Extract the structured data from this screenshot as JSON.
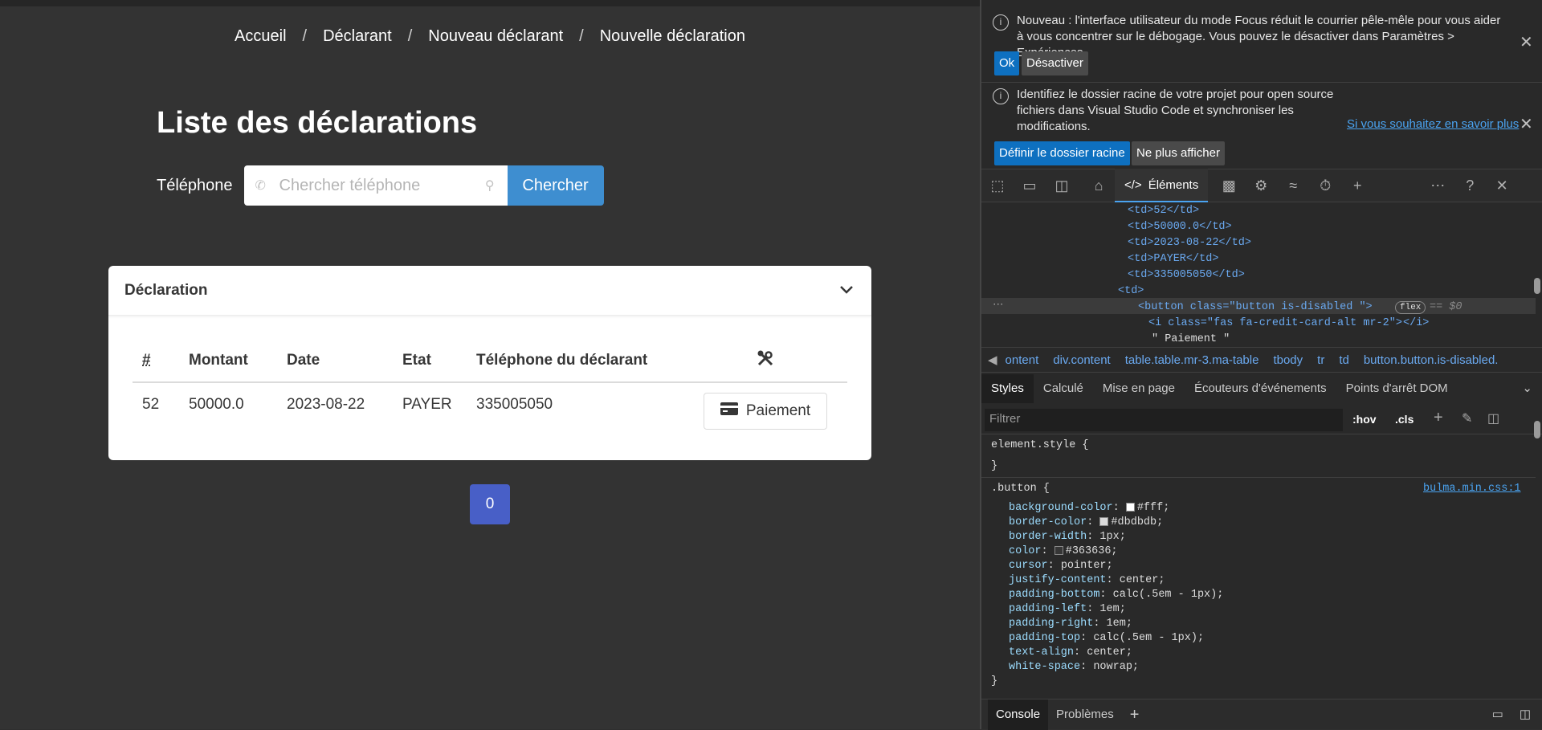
{
  "breadcrumb": {
    "items": [
      "Accueil",
      "Déclarant",
      "Nouveau déclarant",
      "Nouvelle déclaration"
    ],
    "separator": "/"
  },
  "page": {
    "title": "Liste des déclarations"
  },
  "search": {
    "label": "Téléphone",
    "placeholder": "Chercher téléphone",
    "button_label": "Chercher"
  },
  "card": {
    "title": "Déclaration",
    "columns": [
      "#",
      "Montant",
      "Date",
      "Etat",
      "Téléphone du déclarant"
    ],
    "rows": [
      {
        "id": "52",
        "montant": "50000.0",
        "date": "2023-08-22",
        "etat": "PAYER",
        "telephone": "335005050",
        "action_label": "Paiement"
      }
    ]
  },
  "pagination": {
    "current": "0"
  },
  "devtools": {
    "notice1": {
      "text": "Nouveau : l'interface utilisateur du mode Focus réduit le courrier pêle-mêle pour vous aider à vous concentrer sur le débogage. Vous pouvez le désactiver dans Paramètres > Expériences.",
      "ok_label": "Ok",
      "disable_label": "Désactiver"
    },
    "notice2": {
      "text": "Identifiez le dossier racine de votre projet pour open source fichiers dans Visual Studio Code et synchroniser les modifications.",
      "link": "Si vous souhaitez en savoir plus",
      "define_label": "Définir le dossier racine",
      "dismiss_label": "Ne plus afficher"
    },
    "elements_tab": "Éléments",
    "code": {
      "l1": "<td>52</td>",
      "l2": "<td>50000.0</td>",
      "l3": "<td>2023-08-22</td>",
      "l4": "<td>PAYER</td>",
      "l5": "<td>335005050</td>",
      "l6": "<td>",
      "l7_tag": "<button class=\"button is-disabled  \">",
      "l7_badge": "flex",
      "l7_eq": "== $0",
      "l8": "<i class=\"fas fa-credit-card-alt mr-2\">",
      "l8_end": "</i>",
      "l9": "\" Paiement \""
    },
    "crumbs": [
      "ontent",
      "div.content",
      "table.table.mr-3.ma-table",
      "tbody",
      "tr",
      "td",
      "button.button.is-disabled."
    ],
    "subtabs": [
      "Styles",
      "Calculé",
      "Mise en page",
      "Écouteurs d'événements",
      "Points d'arrêt DOM"
    ],
    "filter_placeholder": "Filtrer",
    "hov": ":hov",
    "cls": ".cls",
    "styles": {
      "element_style": "element.style {",
      "close": "}",
      "selector": ".button {",
      "source": "bulma.min.css:1",
      "props": [
        {
          "name": "background-color",
          "value": "#fff;",
          "swatch": "#ffffff"
        },
        {
          "name": "border-color",
          "value": "#dbdbdb;",
          "swatch": "#dbdbdb"
        },
        {
          "name": "border-width",
          "value": "1px;"
        },
        {
          "name": "color",
          "value": "#363636;",
          "swatch": "#363636"
        },
        {
          "name": "cursor",
          "value": "pointer;"
        },
        {
          "name": "justify-content",
          "value": "center;"
        },
        {
          "name": "padding-bottom",
          "value": "calc(.5em - 1px);"
        },
        {
          "name": "padding-left",
          "value": "1em;"
        },
        {
          "name": "padding-right",
          "value": "1em;"
        },
        {
          "name": "padding-top",
          "value": "calc(.5em - 1px);"
        },
        {
          "name": "text-align",
          "value": "center;"
        },
        {
          "name": "white-space",
          "value": "nowrap;"
        }
      ]
    },
    "console_tab": "Console",
    "problems_tab": "Problèmes"
  },
  "colors": {
    "primary_button": "#3e8ed0",
    "pagination": "#485fc7",
    "devtools_accent": "#0e70c0"
  }
}
